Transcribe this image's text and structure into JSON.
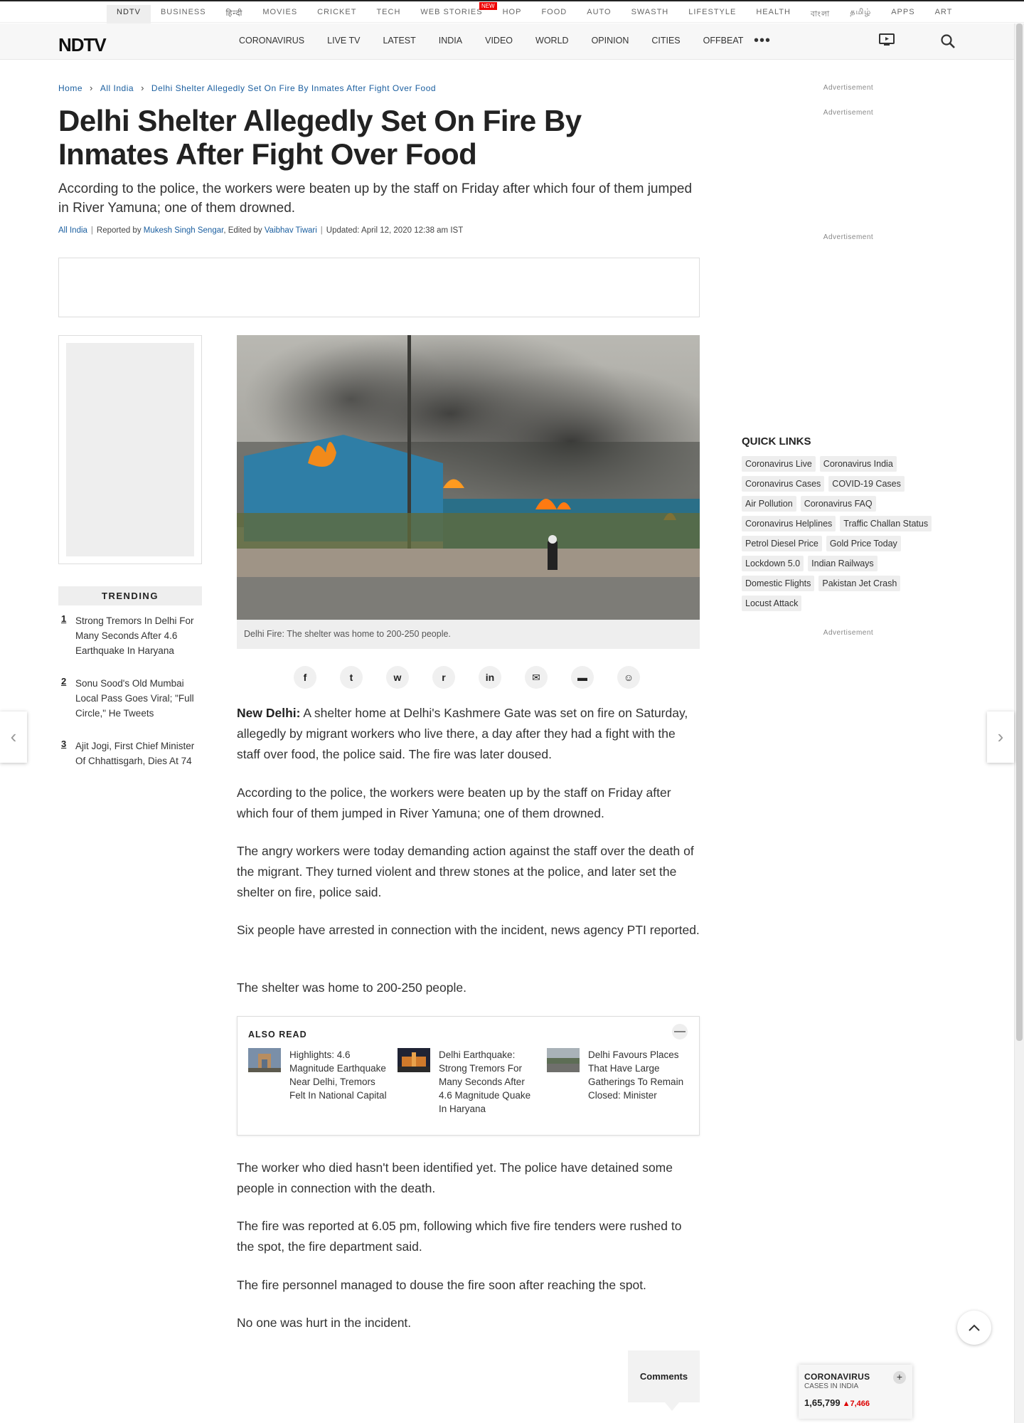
{
  "network_nav": [
    {
      "label": "NDTV",
      "active": true
    },
    {
      "label": "BUSINESS"
    },
    {
      "label": "हिन्दी"
    },
    {
      "label": "MOVIES"
    },
    {
      "label": "CRICKET"
    },
    {
      "label": "TECH"
    },
    {
      "label": "WEB STORIES",
      "badge": "NEW"
    },
    {
      "label": "HOP"
    },
    {
      "label": "FOOD"
    },
    {
      "label": "AUTO"
    },
    {
      "label": "SWASTH"
    },
    {
      "label": "LIFESTYLE"
    },
    {
      "label": "HEALTH"
    },
    {
      "label": "বাংলা"
    },
    {
      "label": "தமிழ்"
    },
    {
      "label": "APPS"
    },
    {
      "label": "ART"
    }
  ],
  "header": {
    "logo": "NDTV",
    "nav": [
      "CORONAVIRUS",
      "LIVE TV",
      "LATEST",
      "INDIA",
      "VIDEO",
      "WORLD",
      "OPINION",
      "CITIES",
      "OFFBEAT"
    ],
    "more": "•••",
    "live_tv_icon": "tv-icon",
    "search_icon": "search-icon"
  },
  "breadcrumb": {
    "items": [
      "Home",
      "All India",
      "Delhi Shelter Allegedly Set On Fire By Inmates After Fight Over Food"
    ],
    "separator": "›"
  },
  "article": {
    "title": "Delhi Shelter Allegedly Set On Fire By Inmates After Fight Over Food",
    "synopsis": "According to the police, the workers were beaten up by the staff on Friday after which four of them jumped in River Yamuna; one of them drowned.",
    "byline": {
      "category": "All India",
      "reported_prefix": "Reported by ",
      "reporter": "Mukesh Singh Sengar",
      "edited_prefix": ", Edited by ",
      "editor": "Vaibhav Tiwari",
      "updated": "Updated: April 12, 2020 12:38 am IST"
    },
    "image_caption": "Delhi Fire: The shelter was home to 200-250 people.",
    "share_icons": [
      "facebook-icon",
      "twitter-icon",
      "whatsapp-icon",
      "reddit-icon",
      "linkedin-icon",
      "email-icon",
      "comment-icon",
      "snapchat-icon"
    ],
    "dateline": "New Delhi:",
    "paragraphs": [
      " A shelter home at Delhi's Kashmere Gate was set on fire on Saturday, allegedly by migrant workers who live there, a day after they had a fight with the staff over food, the police said. The fire was later doused.",
      "According to the police, the workers were beaten up by the staff on Friday after which four of them jumped in River Yamuna; one of them drowned.",
      "The angry workers were today demanding action against the staff over the death of the migrant. They turned violent and threw stones at the police, and later set the shelter on fire, police said.",
      "Six people have arrested in connection with the incident, news agency PTI reported.",
      "The shelter was home to 200-250 people."
    ],
    "paragraphs_after": [
      "The worker who died hasn't been identified yet. The police have detained some people in connection with the death.",
      "The fire was reported at 6.05 pm, following which five fire tenders were rushed to the spot, the fire department said.",
      "The fire personnel managed to douse the fire soon after reaching the spot.",
      "No one was hurt in the incident."
    ],
    "comments_label": "Comments"
  },
  "also_read": {
    "heading": "ALSO READ",
    "close": "—",
    "items": [
      "Highlights: 4.6 Magnitude Earthquake Near Delhi, Tremors Felt In National Capital",
      "Delhi Earthquake: Strong Tremors For Many Seconds After 4.6 Magnitude Quake In Haryana",
      "Delhi Favours Places That Have Large Gatherings To Remain Closed: Minister"
    ]
  },
  "trending": {
    "heading": "TRENDING",
    "items": [
      {
        "num": "1",
        "text": "Strong Tremors In Delhi For Many Seconds After 4.6 Earthquake In Haryana"
      },
      {
        "num": "2",
        "text": "Sonu Sood's Old Mumbai Local Pass Goes Viral; \"Full Circle,\" He Tweets"
      },
      {
        "num": "3",
        "text": "Ajit Jogi, First Chief Minister Of Chhattisgarh, Dies At 74"
      }
    ]
  },
  "sidebar": {
    "ad_label": "Advertisement",
    "quick_links_heading": "QUICK LINKS",
    "quick_links": [
      [
        "Coronavirus Live",
        "Coronavirus India"
      ],
      [
        "Coronavirus Cases",
        "COVID-19 Cases"
      ],
      [
        "Air Pollution",
        "Coronavirus FAQ"
      ],
      [
        "Coronavirus Helplines",
        "Traffic Challan Status"
      ],
      [
        "Petrol Diesel Price",
        "Gold Price Today"
      ],
      [
        "Lockdown 5.0",
        "Indian Railways"
      ],
      [
        "Domestic Flights",
        "Pakistan Jet Crash"
      ],
      [
        "Locust Attack"
      ]
    ]
  },
  "covid_widget": {
    "title": "CORONAVIRUS",
    "subtitle": "CASES IN INDIA",
    "count": "1,65,799",
    "delta": "▲7,466",
    "expand": "+"
  },
  "colors": {
    "link_blue": "#1a5e9f",
    "alert_red": "#d00000",
    "tag_bg": "#eeeeee"
  }
}
